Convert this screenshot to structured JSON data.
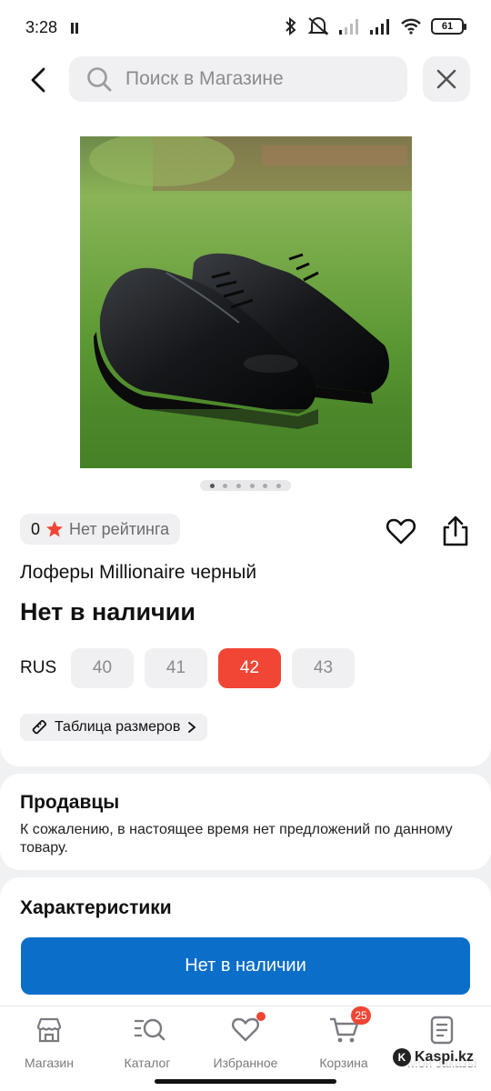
{
  "status_bar": {
    "time": "3:28",
    "battery": "61"
  },
  "search": {
    "placeholder": "Поиск в Магазине"
  },
  "product": {
    "rating_count": "0",
    "rating_label": "Нет рейтинга",
    "title": "Лоферы Millionaire черный",
    "availability": "Нет в наличии",
    "size_system": "RUS",
    "sizes": [
      "40",
      "41",
      "42",
      "43"
    ],
    "selected_size": "42",
    "size_table_label": "Таблица размеров",
    "photo_count": 6,
    "active_photo": 1
  },
  "sellers": {
    "title": "Продавцы",
    "message": "К сожалению, в настоящее время нет предложений по данному товару."
  },
  "specs": {
    "title": "Характеристики"
  },
  "cta_label": "Нет в наличии",
  "tabbar": {
    "items": [
      {
        "label": "Магазин",
        "icon": "store-icon"
      },
      {
        "label": "Каталог",
        "icon": "catalog-icon"
      },
      {
        "label": "Избранное",
        "icon": "heart-icon"
      },
      {
        "label": "Корзина",
        "icon": "cart-icon",
        "badge": "25"
      },
      {
        "label": "Мои заказы",
        "icon": "orders-icon"
      }
    ]
  },
  "watermark": "Kaspi.kz",
  "colors": {
    "accent_red": "#f14635",
    "primary_blue": "#0b6ec9"
  }
}
